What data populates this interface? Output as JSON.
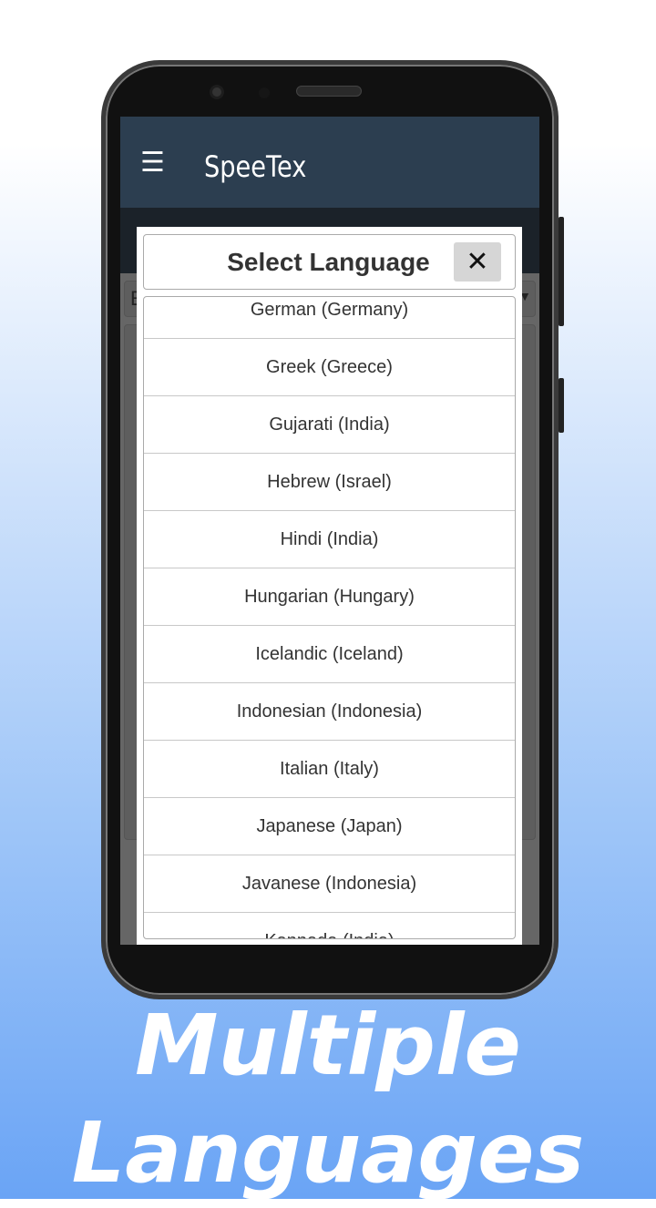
{
  "app": {
    "title": "SpeeTex",
    "menu_icon": "hamburger-menu-icon"
  },
  "background": {
    "select_value": "E"
  },
  "dialog": {
    "title": "Select Language",
    "close_label": "✕",
    "languages": [
      "German (Germany)",
      "Greek (Greece)",
      "Gujarati (India)",
      "Hebrew (Israel)",
      "Hindi (India)",
      "Hungarian (Hungary)",
      "Icelandic (Iceland)",
      "Indonesian (Indonesia)",
      "Italian (Italy)",
      "Japanese (Japan)",
      "Javanese (Indonesia)",
      "Kannada (India)"
    ]
  },
  "tagline": {
    "line1": "Multiple",
    "line2": "Languages"
  }
}
